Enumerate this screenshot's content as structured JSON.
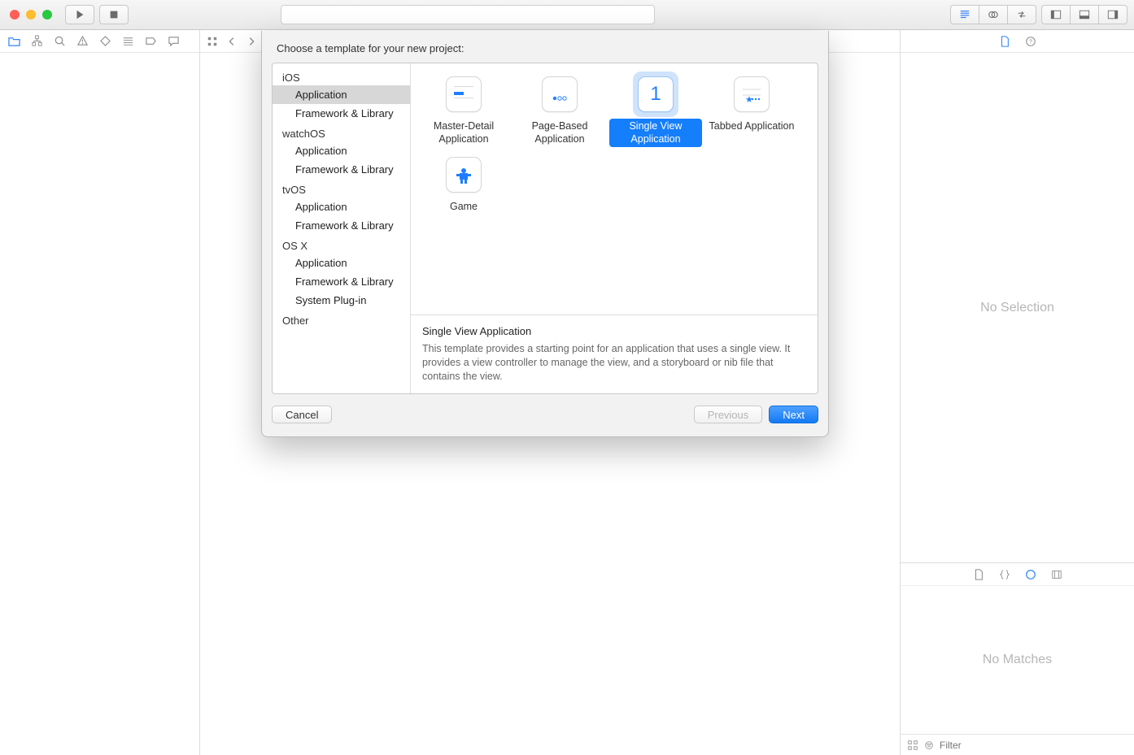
{
  "toolbar": {
    "search_placeholder": ""
  },
  "inspector": {
    "no_selection": "No Selection"
  },
  "library": {
    "no_matches": "No Matches",
    "filter_placeholder": "Filter"
  },
  "modal": {
    "title": "Choose a template for your new project:",
    "categories": [
      {
        "section": "iOS",
        "items": [
          "Application",
          "Framework & Library"
        ],
        "selected_index": 0
      },
      {
        "section": "watchOS",
        "items": [
          "Application",
          "Framework & Library"
        ]
      },
      {
        "section": "tvOS",
        "items": [
          "Application",
          "Framework & Library"
        ]
      },
      {
        "section": "OS X",
        "items": [
          "Application",
          "Framework & Library",
          "System Plug-in"
        ]
      },
      {
        "section": "Other",
        "items": []
      }
    ],
    "templates": [
      {
        "name": "Master-Detail Application"
      },
      {
        "name": "Page-Based Application"
      },
      {
        "name": "Single View Application",
        "selected": true
      },
      {
        "name": "Tabbed Application"
      },
      {
        "name": "Game"
      }
    ],
    "description": {
      "title": "Single View Application",
      "text": "This template provides a starting point for an application that uses a single view. It provides a view controller to manage the view, and a storyboard or nib file that contains the view."
    },
    "buttons": {
      "cancel": "Cancel",
      "previous": "Previous",
      "next": "Next"
    }
  }
}
